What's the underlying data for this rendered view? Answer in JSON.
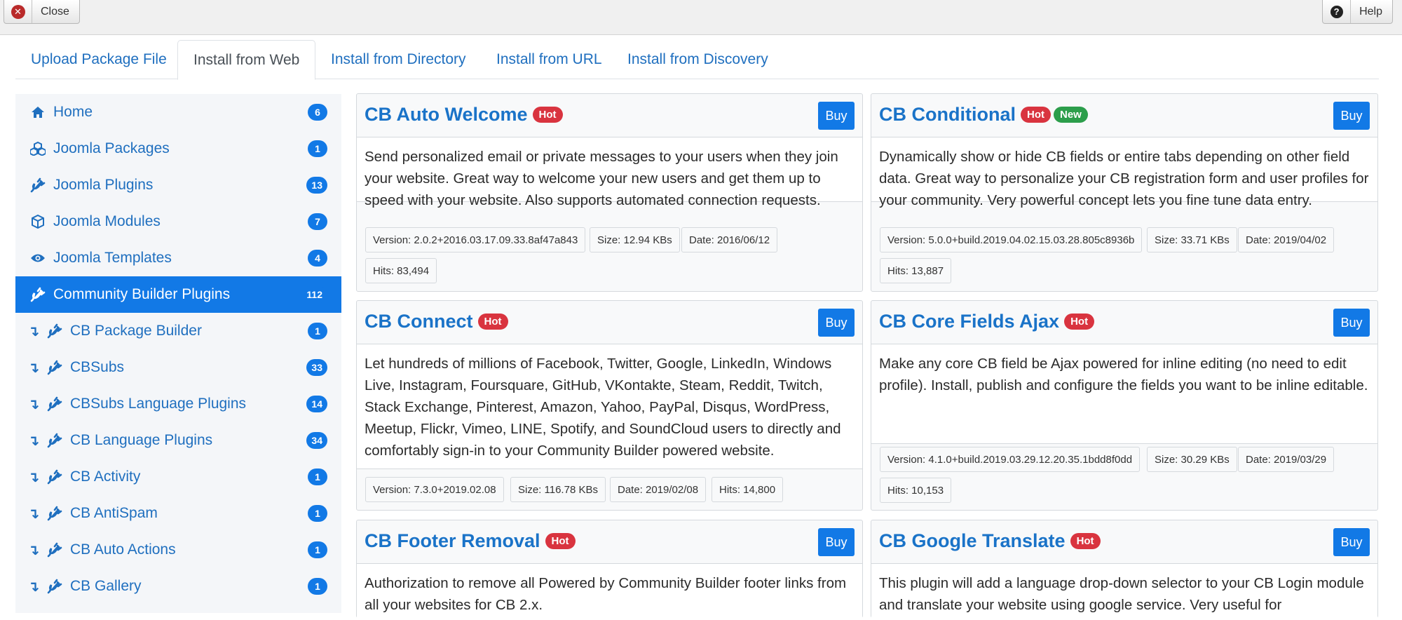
{
  "toolbar": {
    "close_label": "Close",
    "help_label": "Help",
    "close_icon": "close-icon",
    "help_icon": "question-circle-icon"
  },
  "tabs": [
    {
      "label": "Upload Package File"
    },
    {
      "label": "Install from Web",
      "active": true
    },
    {
      "label": "Install from Directory"
    },
    {
      "label": "Install from URL"
    },
    {
      "label": "Install from Discovery"
    }
  ],
  "sidebar": {
    "items": [
      {
        "label": "Home",
        "count": "6",
        "icon": "home-icon"
      },
      {
        "label": "Joomla Packages",
        "count": "1",
        "icon": "cubes-icon"
      },
      {
        "label": "Joomla Plugins",
        "count": "13",
        "icon": "plug-icon"
      },
      {
        "label": "Joomla Modules",
        "count": "7",
        "icon": "cube-icon"
      },
      {
        "label": "Joomla Templates",
        "count": "4",
        "icon": "eye-icon"
      },
      {
        "label": "Community Builder Plugins",
        "count": "112",
        "icon": "plug-icon",
        "active": true
      },
      {
        "label": "CB Package Builder",
        "count": "1",
        "icon": "plug-icon",
        "sub": true
      },
      {
        "label": "CBSubs",
        "count": "33",
        "icon": "plug-icon",
        "sub": true
      },
      {
        "label": "CBSubs Language Plugins",
        "count": "14",
        "icon": "plug-icon",
        "sub": true
      },
      {
        "label": "CB Language Plugins",
        "count": "34",
        "icon": "plug-icon",
        "sub": true
      },
      {
        "label": "CB Activity",
        "count": "1",
        "icon": "plug-icon",
        "sub": true
      },
      {
        "label": "CB AntiSpam",
        "count": "1",
        "icon": "plug-icon",
        "sub": true
      },
      {
        "label": "CB Auto Actions",
        "count": "1",
        "icon": "plug-icon",
        "sub": true
      },
      {
        "label": "CB Gallery",
        "count": "1",
        "icon": "plug-icon",
        "sub": true
      }
    ],
    "sub_arrow": "↴"
  },
  "cards": [
    {
      "title": "CB Auto Welcome",
      "badges": [
        "Hot"
      ],
      "buy": "Buy",
      "description": "Send personalized email or private messages to your users when they join your website. Great way to welcome your new users and get them up to speed with your website. Also supports automated connection requests.",
      "meta": [
        "Version: 2.0.2+2016.03.17.09.33.8af47a843",
        "Size: 12.94 KBs",
        "Date: 2016/06/12",
        "Hits: 83,494"
      ]
    },
    {
      "title": "CB Conditional",
      "badges": [
        "Hot",
        "New"
      ],
      "buy": "Buy",
      "description": "Dynamically show or hide CB fields or entire tabs depending on other field data. Great way to personalize your CB registration form and user profiles for your community. Very powerful concept lets you fine tune data entry.",
      "meta": [
        "Version: 5.0.0+build.2019.04.02.15.03.28.805c8936b",
        "Size: 33.71 KBs",
        "Date: 2019/04/02",
        "Hits: 13,887"
      ]
    },
    {
      "title": "CB Connect",
      "badges": [
        "Hot"
      ],
      "buy": "Buy",
      "description": "Let hundreds of millions of Facebook, Twitter, Google, LinkedIn, Windows Live, Instagram, Foursquare, GitHub, VKontakte, Steam, Reddit, Twitch, Stack Exchange, Pinterest, Amazon, Yahoo, PayPal, Disqus, WordPress, Meetup, Flickr, Vimeo, LINE, Spotify, and SoundCloud users to directly and comfortably sign-in to your Community Builder powered website.",
      "meta": [
        "Version: 7.3.0+2019.02.08",
        "Size: 116.78 KBs",
        "Date: 2019/02/08",
        "Hits: 14,800"
      ]
    },
    {
      "title": "CB Core Fields Ajax",
      "badges": [
        "Hot"
      ],
      "buy": "Buy",
      "description": "Make any core CB field be Ajax powered for inline editing (no need to edit profile). Install, publish and configure the fields you want to be inline editable.",
      "meta": [
        "Version: 4.1.0+build.2019.03.29.12.20.35.1bdd8f0dd",
        "Size: 30.29 KBs",
        "Date: 2019/03/29",
        "Hits: 10,153"
      ]
    },
    {
      "title": "CB Footer Removal",
      "badges": [
        "Hot"
      ],
      "buy": "Buy",
      "description": "Authorization to remove all Powered by Community Builder footer links from all your websites for CB 2.x."
    },
    {
      "title": "CB Google Translate",
      "badges": [
        "Hot"
      ],
      "buy": "Buy",
      "description": "This plugin will add a language drop-down selector to your CB Login module and translate your website using google service. Very useful for"
    }
  ],
  "colors": {
    "accent": "#1279e6",
    "link": "#1f6fbf",
    "hot": "#d9343f",
    "new": "#2c9e4b"
  }
}
